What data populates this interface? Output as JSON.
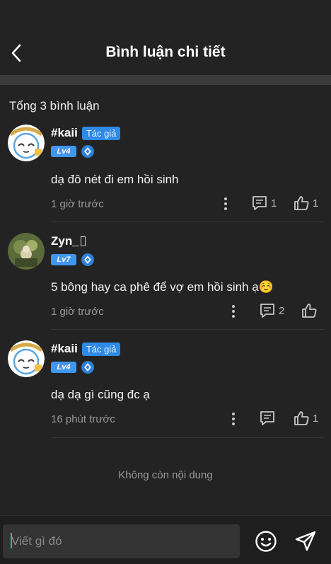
{
  "header": {
    "title": "Bình luận chi tiết"
  },
  "count_label": "Tổng 3 bình luận",
  "comments": [
    {
      "name": "#kaii",
      "badge": "Tác giả",
      "level": "Lv4",
      "text": "dạ đô nét đi em hồi sinh",
      "time": "1 giờ trước",
      "reply_count": "1",
      "like_count": "1"
    },
    {
      "name": "Zyn_",
      "level": "Lv7",
      "text": "5 bông hay ca phê để vợ em hồi sinh ạ☺️",
      "time": "1 giờ trước",
      "reply_count": "2",
      "like_count": ""
    },
    {
      "name": "#kaii",
      "badge": "Tác giả",
      "level": "Lv4",
      "text": "dạ dạ gì cũng đc ạ",
      "time": "16 phút trước",
      "reply_count": "",
      "like_count": "1"
    }
  ],
  "end_note": "Không còn nội dung",
  "footer": {
    "placeholder": "Viết gì đó"
  },
  "colors": {
    "accent": "#2e8ae6",
    "background": "#232323",
    "cursor": "#2bbfa4"
  },
  "icons": [
    "back-icon",
    "more-vert-icon",
    "comment-icon",
    "thumb-up-icon",
    "smile-icon",
    "send-icon",
    "gem-icon"
  ]
}
